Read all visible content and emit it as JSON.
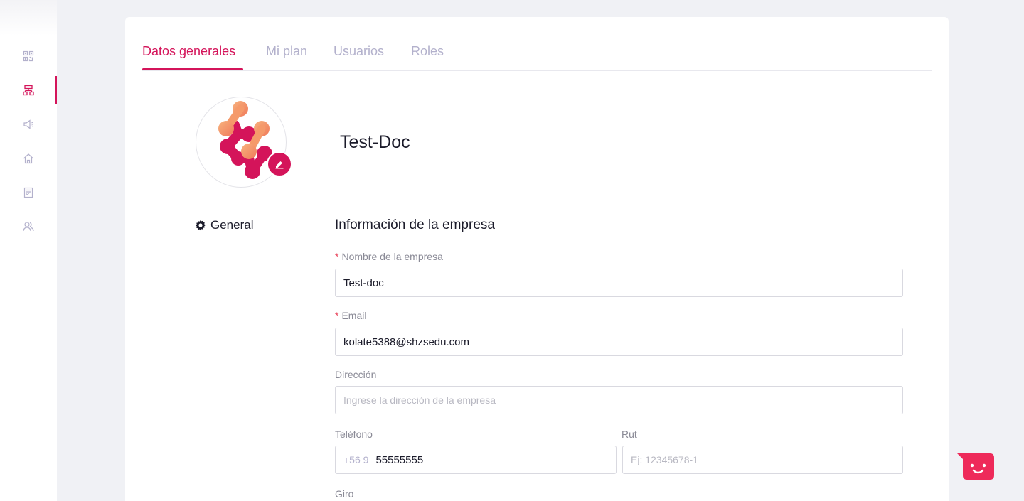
{
  "sidebar": {
    "items": [
      {
        "icon": "qr-code-icon",
        "active": false
      },
      {
        "icon": "sitemap-icon",
        "active": true
      },
      {
        "icon": "megaphone-icon",
        "active": false
      },
      {
        "icon": "home-icon",
        "active": false
      },
      {
        "icon": "document-icon",
        "active": false
      },
      {
        "icon": "users-icon",
        "active": false
      }
    ]
  },
  "tabs": [
    {
      "label": "Datos generales",
      "active": true
    },
    {
      "label": "Mi plan",
      "active": false
    },
    {
      "label": "Usuarios",
      "active": false
    },
    {
      "label": "Roles",
      "active": false
    }
  ],
  "company": {
    "name": "Test-Doc"
  },
  "general_label": "General",
  "section_title": "Información de la empresa",
  "form": {
    "name_label": "Nombre de la empresa",
    "name_value": "Test-doc",
    "email_label": "Email",
    "email_value": "kolate5388@shzsedu.com",
    "address_label": "Dirección",
    "address_placeholder": "Ingrese la dirección de la empresa",
    "phone_label": "Teléfono",
    "phone_prefix": "+56 9",
    "phone_value": "55555555",
    "rut_label": "Rut",
    "rut_placeholder": "Ej: 12345678-1",
    "giro_label": "Giro",
    "required_mark": "*"
  },
  "colors": {
    "accent": "#d4145a",
    "tab_inactive": "#b3b1cc",
    "background": "#f0f1f5",
    "logo_orange": "#f59a6a",
    "logo_magenta": "#d4145a"
  }
}
